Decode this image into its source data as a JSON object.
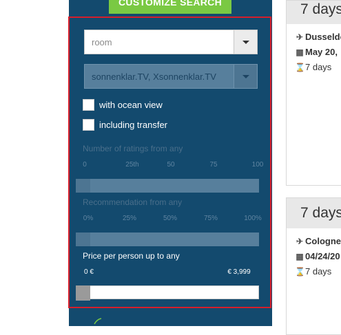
{
  "customize_label": "CUSTOMIZE SEARCH",
  "room_select": {
    "placeholder": "room"
  },
  "tv_select": {
    "value": "sonnenklar.TV, Xsonnenklar.TV"
  },
  "checkboxes": [
    {
      "label": "with ocean view"
    },
    {
      "label": "including transfer"
    }
  ],
  "ratings": {
    "label": "Number of ratings from any",
    "ticks": [
      "0",
      "25th",
      "50",
      "75",
      "100"
    ],
    "level": 0
  },
  "recommendation": {
    "label": "Recommendation from any",
    "ticks": [
      "0%",
      "25%",
      "50%",
      "75%",
      "100%"
    ],
    "level": 0
  },
  "price": {
    "label": "Price per person up to any",
    "min_label": "0 €",
    "max_label": "€ 3,999",
    "level": 0
  },
  "cards": [
    {
      "duration": "7 days",
      "origin": "Dusseldo",
      "date": "May 20,",
      "nights": "7 days"
    },
    {
      "duration": "7 days",
      "origin": "Cologne",
      "date": "04/24/20",
      "nights": "7 days"
    }
  ],
  "colors": {
    "sidebar": "#134a6e",
    "accent_green": "#7ac943",
    "highlight_border": "#d61e2b"
  }
}
